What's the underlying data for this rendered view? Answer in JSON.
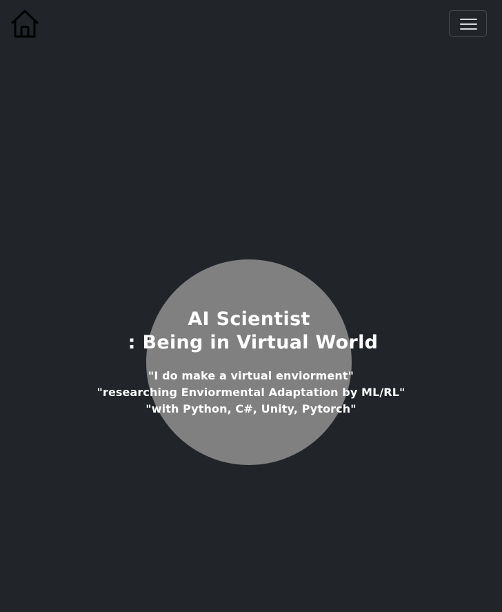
{
  "navbar": {
    "home_icon": "home-icon",
    "toggler_icon": "hamburger-menu-icon"
  },
  "hero": {
    "title_line1": "AI Scientist",
    "title_line2": ": Being in Virtual World",
    "line1": "\"I do make a virtual enviorment\"",
    "line2": "\"researching Enviormental Adaptation by ML/RL\"",
    "line3": "\"with Python, C#, Unity, Pytorch\""
  },
  "colors": {
    "background": "#212529",
    "circle": "#808080",
    "text": "#ffffff"
  }
}
